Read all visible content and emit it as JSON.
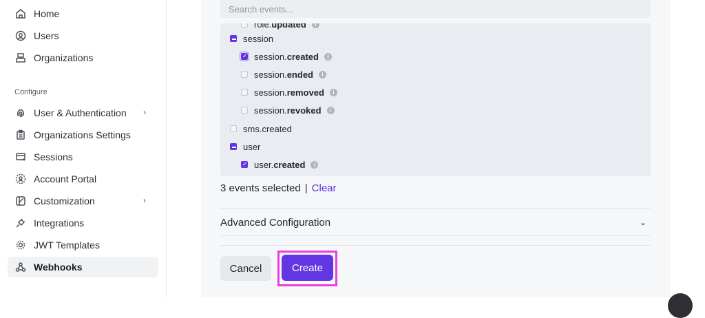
{
  "sidebar": {
    "items": [
      {
        "label": "Home",
        "icon": "home-icon"
      },
      {
        "label": "Users",
        "icon": "user-circle-icon"
      },
      {
        "label": "Organizations",
        "icon": "building-icon"
      }
    ],
    "section_label": "Configure",
    "config_items": [
      {
        "label": "User & Authentication",
        "icon": "fingerprint-icon",
        "chevron": "›"
      },
      {
        "label": "Organizations Settings",
        "icon": "clipboard-icon"
      },
      {
        "label": "Sessions",
        "icon": "session-icon"
      },
      {
        "label": "Account Portal",
        "icon": "portal-icon"
      },
      {
        "label": "Customization",
        "icon": "palette-icon",
        "chevron": "›"
      },
      {
        "label": "Integrations",
        "icon": "plug-icon"
      },
      {
        "label": "JWT Templates",
        "icon": "gear-icon"
      },
      {
        "label": "Webhooks",
        "icon": "webhook-icon",
        "active": true
      }
    ]
  },
  "search": {
    "placeholder": "Search events..."
  },
  "events": {
    "cut_item": {
      "prefix": "role.",
      "strong": "updated"
    },
    "groups": [
      {
        "label": "session",
        "state": "indeterminate",
        "children": [
          {
            "prefix": "session.",
            "strong": "created",
            "checked": true
          },
          {
            "prefix": "session.",
            "strong": "ended",
            "checked": false
          },
          {
            "prefix": "session.",
            "strong": "removed",
            "checked": false
          },
          {
            "prefix": "session.",
            "strong": "revoked",
            "checked": false
          }
        ]
      },
      {
        "label": "sms.created",
        "state": "unchecked",
        "children": []
      },
      {
        "label": "user",
        "state": "indeterminate",
        "children": [
          {
            "prefix": "user.",
            "strong": "created",
            "checked": true
          }
        ]
      }
    ],
    "info_glyph": "i"
  },
  "selection": {
    "count_text": "3 events selected",
    "separator": "|",
    "clear_label": "Clear"
  },
  "advanced": {
    "label": "Advanced Configuration",
    "chevron": "⌄"
  },
  "actions": {
    "cancel_label": "Cancel",
    "create_label": "Create"
  },
  "colors": {
    "accent": "#6236e3",
    "highlight": "#e93ee0"
  }
}
